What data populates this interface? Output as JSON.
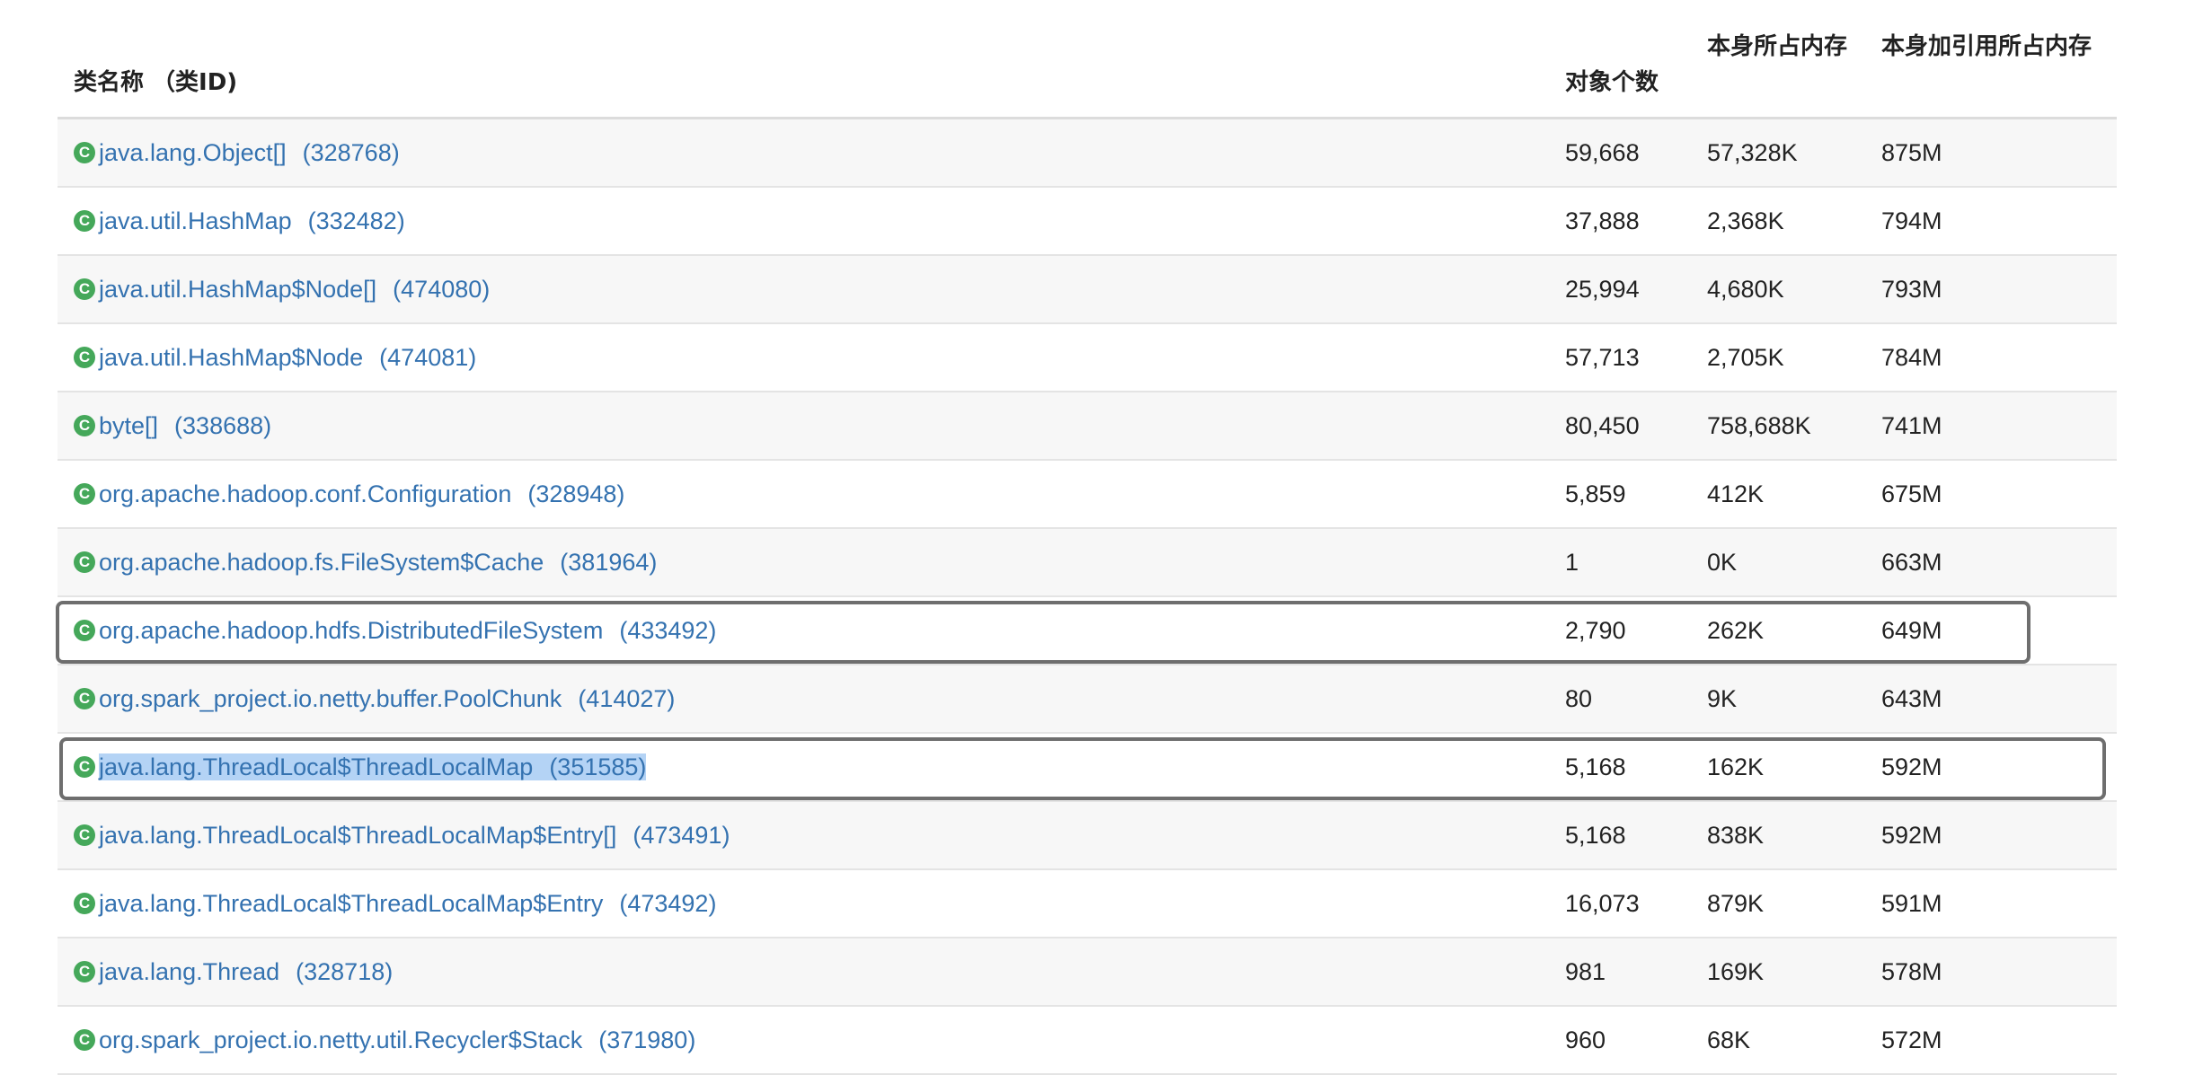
{
  "table": {
    "headers": {
      "name": "类名称 （类ID)",
      "count": "对象个数",
      "shallow": "本身所占内存",
      "retained": "本身加引用所占内存"
    },
    "rows": [
      {
        "icon": "class-icon",
        "icon_glyph": "C",
        "name": "java.lang.Object[]",
        "id": "(328768)",
        "count": "59,668",
        "shallow": "57,328K",
        "retained": "875M"
      },
      {
        "icon": "class-icon",
        "icon_glyph": "C",
        "name": "java.util.HashMap",
        "id": "(332482)",
        "count": "37,888",
        "shallow": "2,368K",
        "retained": "794M"
      },
      {
        "icon": "class-icon",
        "icon_glyph": "C",
        "name": "java.util.HashMap$Node[]",
        "id": "(474080)",
        "count": "25,994",
        "shallow": "4,680K",
        "retained": "793M"
      },
      {
        "icon": "class-icon",
        "icon_glyph": "C",
        "name": "java.util.HashMap$Node",
        "id": "(474081)",
        "count": "57,713",
        "shallow": "2,705K",
        "retained": "784M"
      },
      {
        "icon": "class-icon",
        "icon_glyph": "C",
        "name": "byte[]",
        "id": "(338688)",
        "count": "80,450",
        "shallow": "758,688K",
        "retained": "741M"
      },
      {
        "icon": "class-icon",
        "icon_glyph": "C",
        "name": "org.apache.hadoop.conf.Configuration",
        "id": "(328948)",
        "count": "5,859",
        "shallow": "412K",
        "retained": "675M"
      },
      {
        "icon": "class-icon",
        "icon_glyph": "C",
        "name": "org.apache.hadoop.fs.FileSystem$Cache",
        "id": "(381964)",
        "count": "1",
        "shallow": "0K",
        "retained": "663M"
      },
      {
        "icon": "class-icon",
        "icon_glyph": "C",
        "name": "org.apache.hadoop.hdfs.DistributedFileSystem",
        "id": "(433492)",
        "count": "2,790",
        "shallow": "262K",
        "retained": "649M",
        "boxed": true
      },
      {
        "icon": "class-icon",
        "icon_glyph": "C",
        "name": "org.spark_project.io.netty.buffer.PoolChunk",
        "id": "(414027)",
        "count": "80",
        "shallow": "9K",
        "retained": "643M"
      },
      {
        "icon": "class-icon",
        "icon_glyph": "C",
        "name": "java.lang.ThreadLocal$ThreadLocalMap",
        "id": "(351585)",
        "count": "5,168",
        "shallow": "162K",
        "retained": "592M",
        "boxed": true,
        "text_selected": true
      },
      {
        "icon": "class-icon",
        "icon_glyph": "C",
        "name": "java.lang.ThreadLocal$ThreadLocalMap$Entry[]",
        "id": "(473491)",
        "count": "5,168",
        "shallow": "838K",
        "retained": "592M"
      },
      {
        "icon": "class-icon",
        "icon_glyph": "C",
        "name": "java.lang.ThreadLocal$ThreadLocalMap$Entry",
        "id": "(473492)",
        "count": "16,073",
        "shallow": "879K",
        "retained": "591M"
      },
      {
        "icon": "class-icon",
        "icon_glyph": "C",
        "name": "java.lang.Thread",
        "id": "(328718)",
        "count": "981",
        "shallow": "169K",
        "retained": "578M"
      },
      {
        "icon": "class-icon",
        "icon_glyph": "C",
        "name": "org.spark_project.io.netty.util.Recycler$Stack",
        "id": "(371980)",
        "count": "960",
        "shallow": "68K",
        "retained": "572M"
      }
    ]
  },
  "colors": {
    "link": "#3472b0",
    "icon_bg": "#45a85a",
    "selection": "#b4d3f5",
    "box_border": "#6e6e6e",
    "row_alt": "#f7f7f7"
  }
}
